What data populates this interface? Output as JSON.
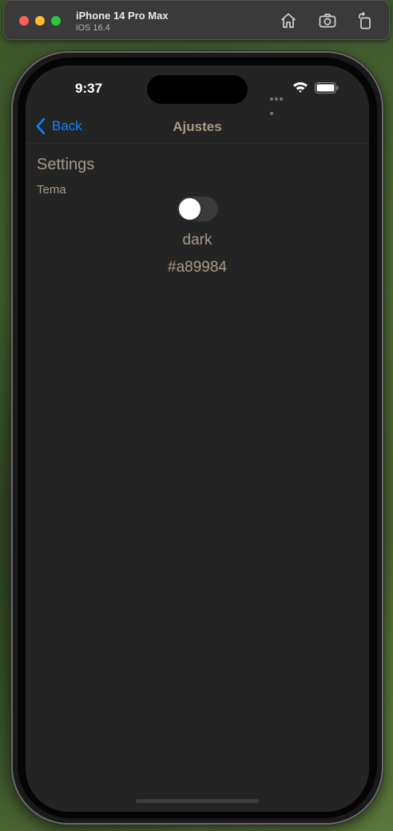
{
  "simulator": {
    "device_name": "iPhone 14 Pro Max",
    "os_version": "iOS 16.4",
    "toolbar_icons": [
      "home-icon",
      "screenshot-icon",
      "rotate-icon"
    ]
  },
  "status_bar": {
    "time": "9:37",
    "icons": [
      "cellular-dots-icon",
      "wifi-icon",
      "battery-icon"
    ]
  },
  "nav": {
    "back_label": "Back",
    "title": "Ajustes"
  },
  "content": {
    "heading": "Settings",
    "theme_label": "Tema",
    "theme_toggle_on": false,
    "mode_value": "dark",
    "color_value": "#a89984"
  },
  "colors": {
    "accent": "#0a84ff",
    "text": "#a89984",
    "background": "#242424"
  }
}
